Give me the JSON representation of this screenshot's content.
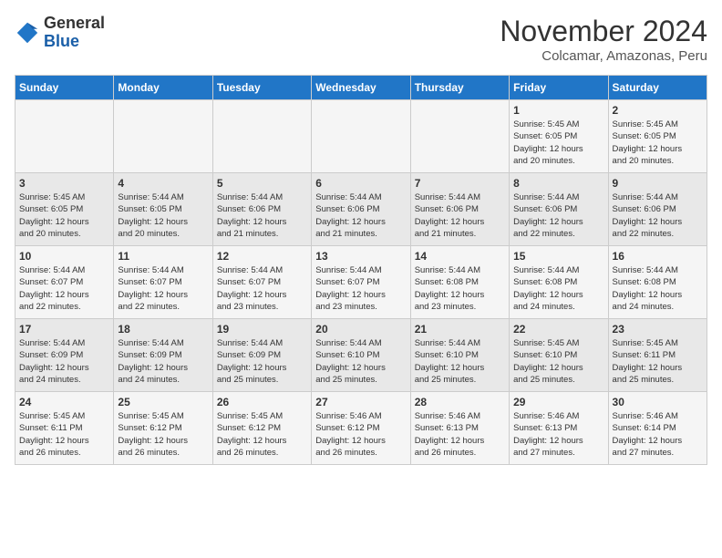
{
  "header": {
    "logo_general": "General",
    "logo_blue": "Blue",
    "month_title": "November 2024",
    "subtitle": "Colcamar, Amazonas, Peru"
  },
  "days_of_week": [
    "Sunday",
    "Monday",
    "Tuesday",
    "Wednesday",
    "Thursday",
    "Friday",
    "Saturday"
  ],
  "weeks": [
    [
      {
        "day": "",
        "info": ""
      },
      {
        "day": "",
        "info": ""
      },
      {
        "day": "",
        "info": ""
      },
      {
        "day": "",
        "info": ""
      },
      {
        "day": "",
        "info": ""
      },
      {
        "day": "1",
        "info": "Sunrise: 5:45 AM\nSunset: 6:05 PM\nDaylight: 12 hours\nand 20 minutes."
      },
      {
        "day": "2",
        "info": "Sunrise: 5:45 AM\nSunset: 6:05 PM\nDaylight: 12 hours\nand 20 minutes."
      }
    ],
    [
      {
        "day": "3",
        "info": "Sunrise: 5:45 AM\nSunset: 6:05 PM\nDaylight: 12 hours\nand 20 minutes."
      },
      {
        "day": "4",
        "info": "Sunrise: 5:44 AM\nSunset: 6:05 PM\nDaylight: 12 hours\nand 20 minutes."
      },
      {
        "day": "5",
        "info": "Sunrise: 5:44 AM\nSunset: 6:06 PM\nDaylight: 12 hours\nand 21 minutes."
      },
      {
        "day": "6",
        "info": "Sunrise: 5:44 AM\nSunset: 6:06 PM\nDaylight: 12 hours\nand 21 minutes."
      },
      {
        "day": "7",
        "info": "Sunrise: 5:44 AM\nSunset: 6:06 PM\nDaylight: 12 hours\nand 21 minutes."
      },
      {
        "day": "8",
        "info": "Sunrise: 5:44 AM\nSunset: 6:06 PM\nDaylight: 12 hours\nand 22 minutes."
      },
      {
        "day": "9",
        "info": "Sunrise: 5:44 AM\nSunset: 6:06 PM\nDaylight: 12 hours\nand 22 minutes."
      }
    ],
    [
      {
        "day": "10",
        "info": "Sunrise: 5:44 AM\nSunset: 6:07 PM\nDaylight: 12 hours\nand 22 minutes."
      },
      {
        "day": "11",
        "info": "Sunrise: 5:44 AM\nSunset: 6:07 PM\nDaylight: 12 hours\nand 22 minutes."
      },
      {
        "day": "12",
        "info": "Sunrise: 5:44 AM\nSunset: 6:07 PM\nDaylight: 12 hours\nand 23 minutes."
      },
      {
        "day": "13",
        "info": "Sunrise: 5:44 AM\nSunset: 6:07 PM\nDaylight: 12 hours\nand 23 minutes."
      },
      {
        "day": "14",
        "info": "Sunrise: 5:44 AM\nSunset: 6:08 PM\nDaylight: 12 hours\nand 23 minutes."
      },
      {
        "day": "15",
        "info": "Sunrise: 5:44 AM\nSunset: 6:08 PM\nDaylight: 12 hours\nand 24 minutes."
      },
      {
        "day": "16",
        "info": "Sunrise: 5:44 AM\nSunset: 6:08 PM\nDaylight: 12 hours\nand 24 minutes."
      }
    ],
    [
      {
        "day": "17",
        "info": "Sunrise: 5:44 AM\nSunset: 6:09 PM\nDaylight: 12 hours\nand 24 minutes."
      },
      {
        "day": "18",
        "info": "Sunrise: 5:44 AM\nSunset: 6:09 PM\nDaylight: 12 hours\nand 24 minutes."
      },
      {
        "day": "19",
        "info": "Sunrise: 5:44 AM\nSunset: 6:09 PM\nDaylight: 12 hours\nand 25 minutes."
      },
      {
        "day": "20",
        "info": "Sunrise: 5:44 AM\nSunset: 6:10 PM\nDaylight: 12 hours\nand 25 minutes."
      },
      {
        "day": "21",
        "info": "Sunrise: 5:44 AM\nSunset: 6:10 PM\nDaylight: 12 hours\nand 25 minutes."
      },
      {
        "day": "22",
        "info": "Sunrise: 5:45 AM\nSunset: 6:10 PM\nDaylight: 12 hours\nand 25 minutes."
      },
      {
        "day": "23",
        "info": "Sunrise: 5:45 AM\nSunset: 6:11 PM\nDaylight: 12 hours\nand 25 minutes."
      }
    ],
    [
      {
        "day": "24",
        "info": "Sunrise: 5:45 AM\nSunset: 6:11 PM\nDaylight: 12 hours\nand 26 minutes."
      },
      {
        "day": "25",
        "info": "Sunrise: 5:45 AM\nSunset: 6:12 PM\nDaylight: 12 hours\nand 26 minutes."
      },
      {
        "day": "26",
        "info": "Sunrise: 5:45 AM\nSunset: 6:12 PM\nDaylight: 12 hours\nand 26 minutes."
      },
      {
        "day": "27",
        "info": "Sunrise: 5:46 AM\nSunset: 6:12 PM\nDaylight: 12 hours\nand 26 minutes."
      },
      {
        "day": "28",
        "info": "Sunrise: 5:46 AM\nSunset: 6:13 PM\nDaylight: 12 hours\nand 26 minutes."
      },
      {
        "day": "29",
        "info": "Sunrise: 5:46 AM\nSunset: 6:13 PM\nDaylight: 12 hours\nand 27 minutes."
      },
      {
        "day": "30",
        "info": "Sunrise: 5:46 AM\nSunset: 6:14 PM\nDaylight: 12 hours\nand 27 minutes."
      }
    ]
  ]
}
